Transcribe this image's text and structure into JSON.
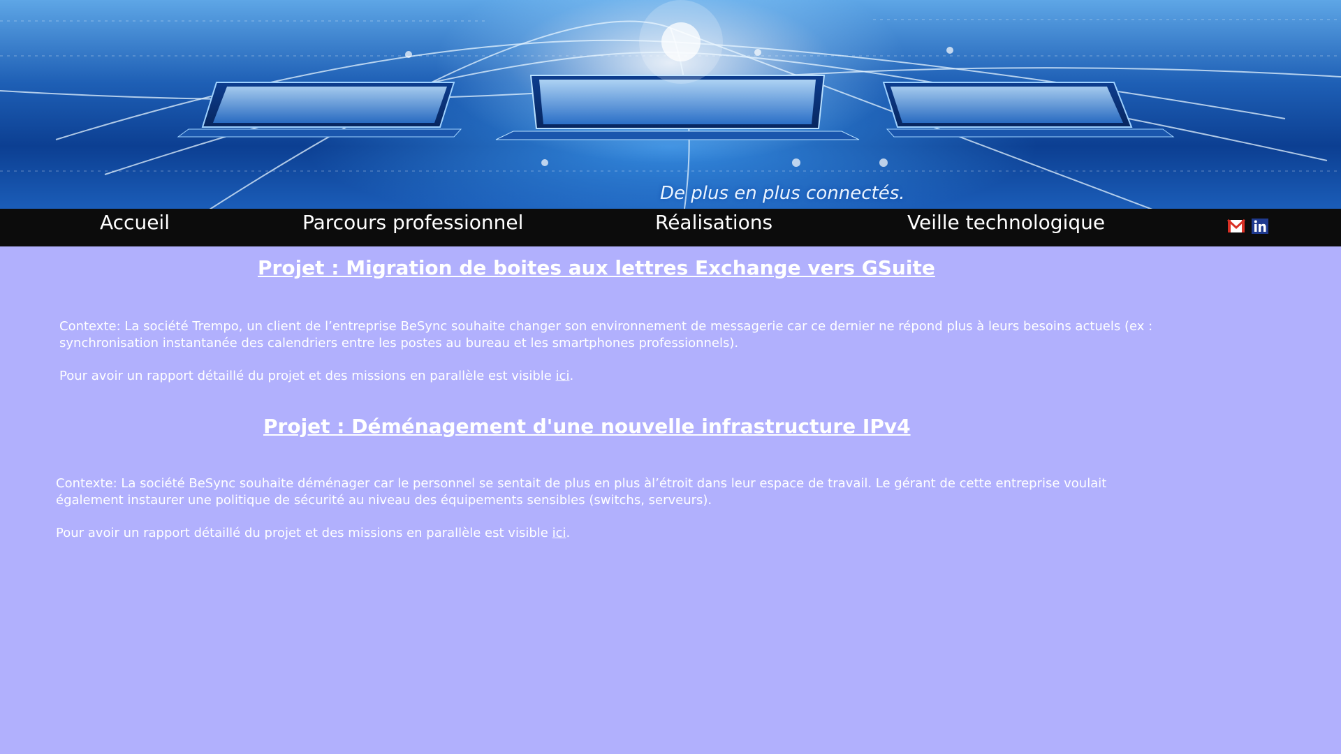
{
  "header": {
    "tagline": "De plus en plus connectés."
  },
  "nav": {
    "items": [
      "Accueil",
      "Parcours professionnel",
      "Réalisations",
      "Veille technologique"
    ],
    "social": [
      {
        "name": "gmail-icon",
        "color": "#d93025"
      },
      {
        "name": "linkedin-icon",
        "color": "#0a66c2"
      }
    ]
  },
  "projects": [
    {
      "title": "Projet : Migration de boites aux lettres Exchange vers GSuite",
      "context": "Contexte: La société Trempo, un client de l’entreprise BeSync souhaite changer son environnement de messagerie car ce dernier ne répond plus à leurs besoins actuels (ex : synchronisation instantanée des calendriers entre les postes au bureau et les smartphones professionnels).",
      "report_text": "Pour avoir un rapport détaillé du  projet et des missions en parallèle est visible",
      "link_label": "ici",
      "period": "."
    },
    {
      "title": "Projet : Déménagement d'une nouvelle infrastructure IPv4",
      "context": "Contexte: La société BeSync souhaite déménager car le personnel se sentait de plus en plus àl’étroit dans leur espace de travail. Le gérant de cette entreprise voulait également instaurer une politique de sécurité au niveau des équipements sensibles (switchs, serveurs).",
      "report_text": "Pour avoir un rapport détaillé du projet et des missions en parallèle est visible",
      "link_label": "ici",
      "period": "."
    }
  ],
  "colors": {
    "page_background": "#b1b0fd",
    "navbar_background": "#0c0c0c",
    "text": "#ffffff"
  }
}
